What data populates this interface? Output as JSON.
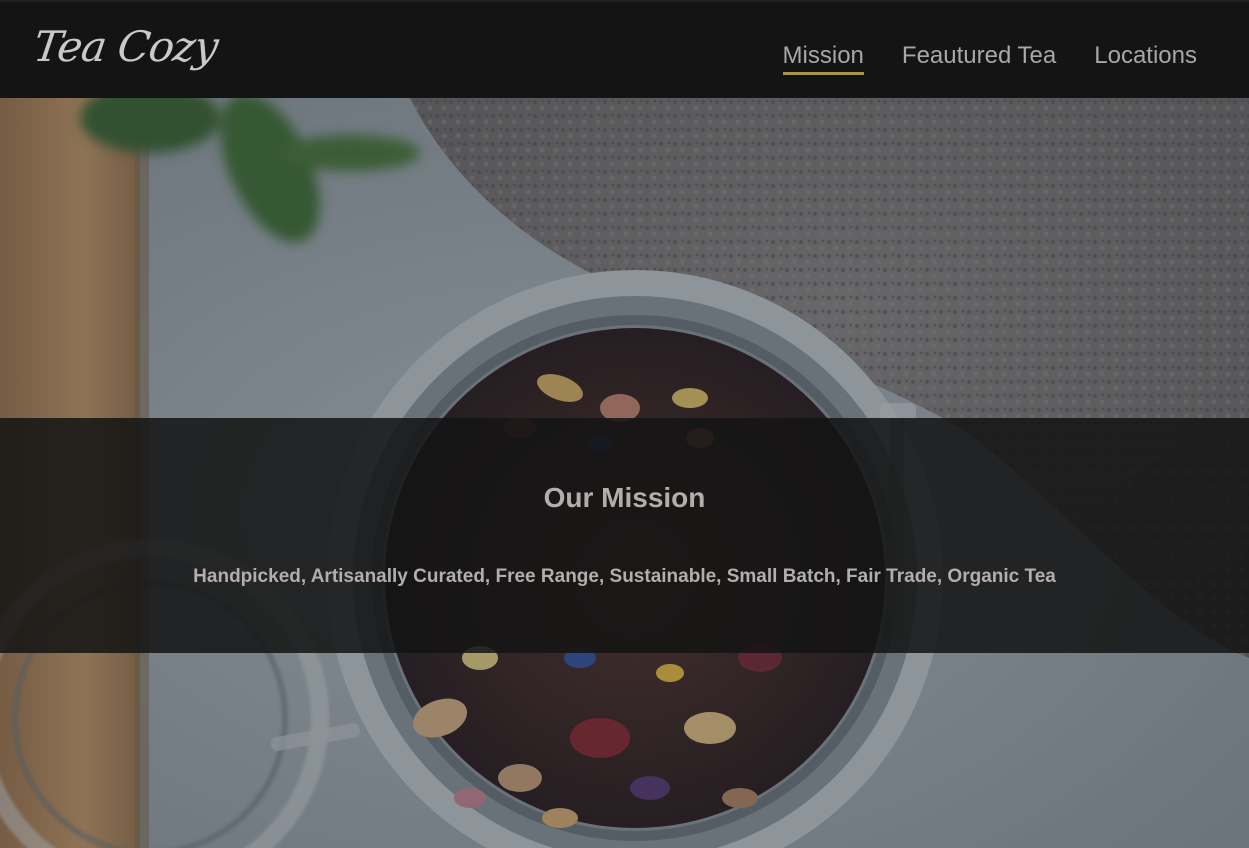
{
  "header": {
    "logo_text": "Tea Cozy",
    "nav": [
      {
        "label": "Mission",
        "active": true
      },
      {
        "label": "Feautured Tea",
        "active": false
      },
      {
        "label": "Locations",
        "active": false
      }
    ]
  },
  "hero": {
    "image": "tea-jar-photo",
    "mission": {
      "title": "Our Mission",
      "text": "Handpicked, Artisanally Curated, Free Range, Sustainable, Small Batch, Fair Trade, Organic Tea"
    }
  },
  "colors": {
    "header_bg": "#141414",
    "nav_text": "#a7a7a7",
    "nav_active_underline": "#a8924f",
    "mission_text": "#b3aeab"
  }
}
